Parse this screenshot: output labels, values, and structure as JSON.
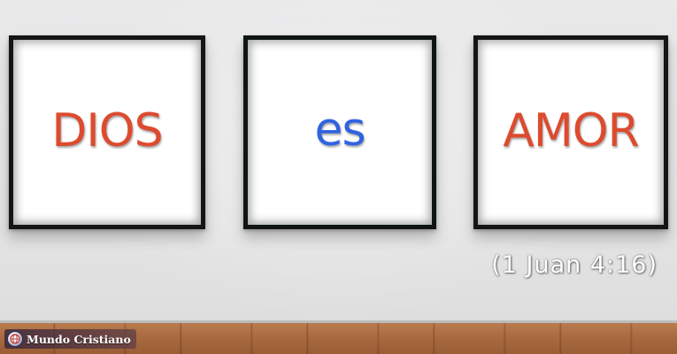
{
  "frames": [
    {
      "word": "DIOS",
      "color": "#dd4b2f"
    },
    {
      "word": "es",
      "color": "#2f63e0"
    },
    {
      "word": "AMOR",
      "color": "#dd4b2f"
    }
  ],
  "verse": "(1 Juan 4:16)",
  "logo": {
    "text": "Mundo Cristiano",
    "icon": "globe-icon"
  },
  "colors": {
    "wall": "#e6e6e7",
    "frame": "#151515",
    "floor": "#a96a3f"
  }
}
